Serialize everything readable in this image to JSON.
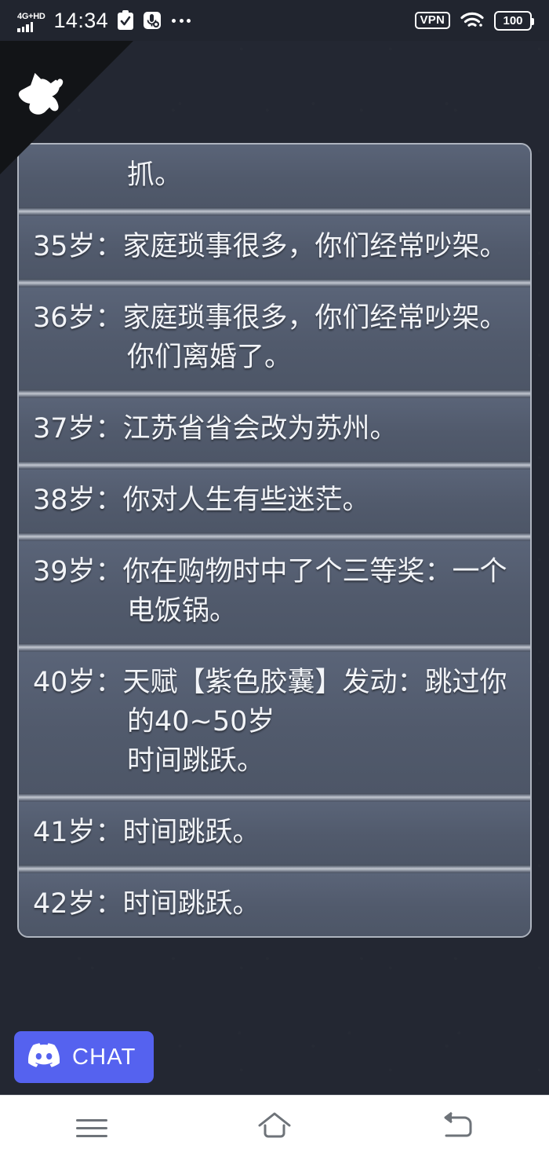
{
  "status_bar": {
    "network_label": "4G+HD",
    "time": "14:34",
    "clipboard_icon": "clipboard-check-icon",
    "mic_mute_icon": "mic-mute-icon",
    "overflow_icon": "more-dots-icon",
    "vpn_label": "VPN",
    "wifi_icon": "wifi-icon",
    "battery_level": "100"
  },
  "branding": {
    "logo_icon": "cat-logo-icon"
  },
  "life_log": {
    "entries": [
      {
        "text": "抓。",
        "wrapped_continuation": true
      },
      {
        "text": "35岁：家庭琐事很多，你们经常吵架。",
        "wrapped_continuation": false
      },
      {
        "text": "36岁：家庭琐事很多，你们经常吵架。\n你们离婚了。",
        "wrapped_continuation": false
      },
      {
        "text": "37岁：江苏省省会改为苏州。",
        "wrapped_continuation": false
      },
      {
        "text": "38岁：你对人生有些迷茫。",
        "wrapped_continuation": false
      },
      {
        "text": "39岁：你在购物时中了个三等奖：一个电饭锅。",
        "wrapped_continuation": false
      },
      {
        "text": "40岁：天赋【紫色胶囊】发动：跳过你的40~50岁\n时间跳跃。",
        "wrapped_continuation": false
      },
      {
        "text": "41岁：时间跳跃。",
        "wrapped_continuation": false
      },
      {
        "text": "42岁：时间跳跃。",
        "wrapped_continuation": false
      }
    ]
  },
  "chat_button": {
    "label": "CHAT",
    "icon": "discord-icon",
    "color": "#5562ef"
  },
  "nav_bar": {
    "recents_icon": "menu-recents-icon",
    "home_icon": "home-icon",
    "back_icon": "back-icon"
  },
  "colors": {
    "page_background": "#232732",
    "row_background": "#535c6e",
    "text": "#f2f4f8",
    "accent": "#5562ef"
  }
}
